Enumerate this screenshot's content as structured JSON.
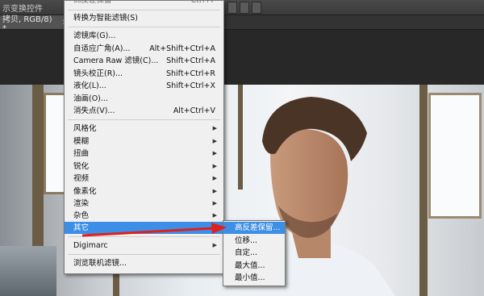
{
  "topbar": {
    "label": "示变换控件"
  },
  "document_tab": {
    "title": "拷贝, RGB/8) *",
    "close": "×"
  },
  "filter_menu": {
    "top_partial": "高反差保留",
    "top_partial_shortcut": "Ctrl+F",
    "items": [
      {
        "label": "转换为智能滤镜(S)",
        "shortcut": "",
        "submenu": false
      },
      {
        "label": "滤镜库(G)...",
        "shortcut": "",
        "submenu": false
      },
      {
        "label": "自适应广角(A)...",
        "shortcut": "Alt+Shift+Ctrl+A",
        "submenu": false
      },
      {
        "label": "Camera Raw 滤镜(C)...",
        "shortcut": "Shift+Ctrl+A",
        "submenu": false
      },
      {
        "label": "镜头校正(R)...",
        "shortcut": "Shift+Ctrl+R",
        "submenu": false
      },
      {
        "label": "液化(L)...",
        "shortcut": "Shift+Ctrl+X",
        "submenu": false
      },
      {
        "label": "油画(O)...",
        "shortcut": "",
        "submenu": false
      },
      {
        "label": "消失点(V)...",
        "shortcut": "Alt+Ctrl+V",
        "submenu": false
      },
      {
        "label": "风格化",
        "shortcut": "",
        "submenu": true
      },
      {
        "label": "模糊",
        "shortcut": "",
        "submenu": true
      },
      {
        "label": "扭曲",
        "shortcut": "",
        "submenu": true
      },
      {
        "label": "锐化",
        "shortcut": "",
        "submenu": true
      },
      {
        "label": "视频",
        "shortcut": "",
        "submenu": true
      },
      {
        "label": "像素化",
        "shortcut": "",
        "submenu": true
      },
      {
        "label": "渲染",
        "shortcut": "",
        "submenu": true
      },
      {
        "label": "杂色",
        "shortcut": "",
        "submenu": true
      },
      {
        "label": "其它",
        "shortcut": "",
        "submenu": true
      },
      {
        "label": "Digimarc",
        "shortcut": "",
        "submenu": true
      },
      {
        "label": "浏览联机滤镜...",
        "shortcut": "",
        "submenu": false
      }
    ]
  },
  "submenu_other": {
    "items": [
      "高反差保留...",
      "位移...",
      "自定...",
      "最大值...",
      "最小值..."
    ]
  },
  "colors": {
    "menu_bg": "#f0f0f0",
    "highlight": "#3d8ee6",
    "arrow": "#e0201a"
  }
}
